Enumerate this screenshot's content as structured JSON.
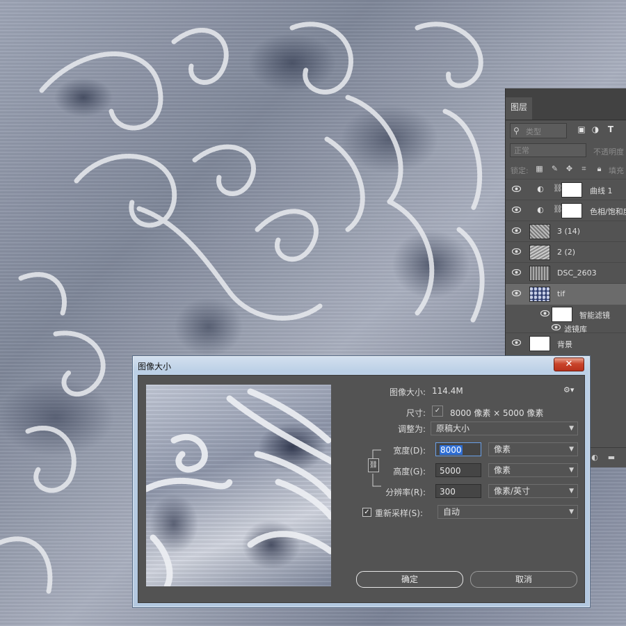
{
  "layers_panel": {
    "tab": "图层",
    "filter_placeholder": "类型",
    "blend_mode": "正常",
    "opacity_label": "不透明度",
    "lock_label": "锁定:",
    "fill_label": "填充",
    "layers": [
      {
        "name": "曲线 1",
        "kind": "adjustment"
      },
      {
        "name": "色相/饱和度",
        "kind": "adjustment"
      },
      {
        "name": "3 (14)",
        "kind": "pixel"
      },
      {
        "name": "2 (2)",
        "kind": "pixel"
      },
      {
        "name": "DSC_2603",
        "kind": "pixel"
      },
      {
        "name": "tif",
        "kind": "smart",
        "selected": true
      },
      {
        "name": "智能滤镜",
        "kind": "smart-filter-mask"
      },
      {
        "name": "滤镜库",
        "kind": "filter"
      },
      {
        "name": "背景",
        "kind": "background"
      }
    ]
  },
  "dialog": {
    "title": "图像大小",
    "close_label": "✕",
    "image_size_label": "图像大小:",
    "image_size_value": "114.4M",
    "dimensions_label": "尺寸:",
    "dimensions_value": "8000 像素 × 5000 像素",
    "fit_to_label": "调整为:",
    "fit_to_value": "原稿大小",
    "width_label": "宽度(D):",
    "width_value": "8000",
    "width_unit": "像素",
    "height_label": "高度(G):",
    "height_value": "5000",
    "height_unit": "像素",
    "resolution_label": "分辨率(R):",
    "resolution_value": "300",
    "resolution_unit": "像素/英寸",
    "resample_label": "重新采样(S):",
    "resample_checked": true,
    "resample_value": "自动",
    "ok_label": "确定",
    "cancel_label": "取消"
  }
}
